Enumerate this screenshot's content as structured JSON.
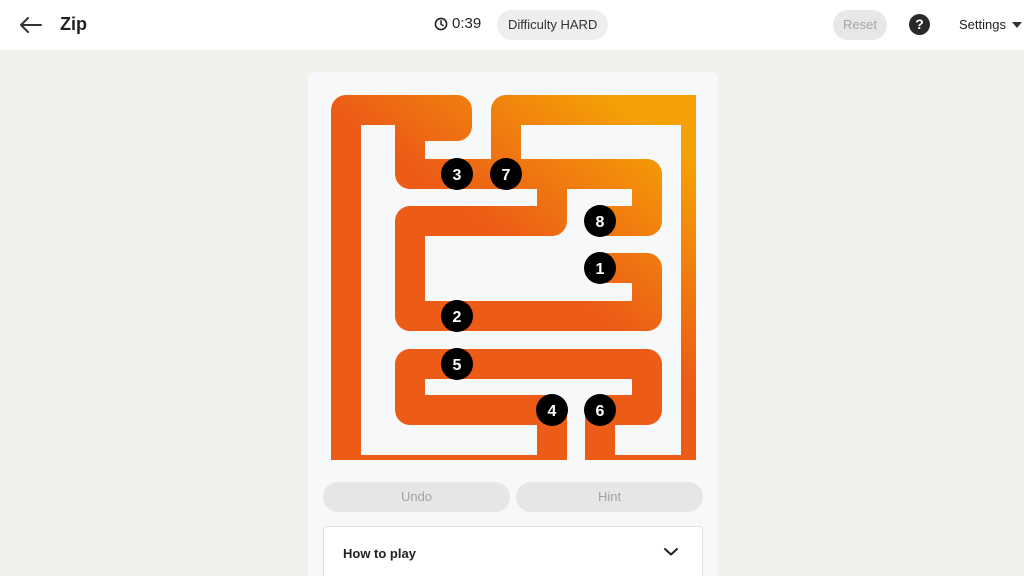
{
  "header": {
    "title": "Zip",
    "timer": "0:39",
    "difficulty": "Difficulty HARD",
    "reset_label": "Reset",
    "help_label": "?",
    "settings_label": "Settings"
  },
  "puzzle": {
    "grid_size": 7,
    "path_colors": {
      "start": "#ec5c17",
      "end": "#f5a106"
    },
    "checkpoints": [
      {
        "label": "1",
        "row": 3,
        "col": 5
      },
      {
        "label": "2",
        "row": 4,
        "col": 2
      },
      {
        "label": "3",
        "row": 1,
        "col": 2
      },
      {
        "label": "4",
        "row": 6,
        "col": 4
      },
      {
        "label": "5",
        "row": 5,
        "col": 2
      },
      {
        "label": "6",
        "row": 6,
        "col": 5
      },
      {
        "label": "7",
        "row": 1,
        "col": 3
      },
      {
        "label": "8",
        "row": 2,
        "col": 5
      }
    ]
  },
  "controls": {
    "undo_label": "Undo",
    "hint_label": "Hint"
  },
  "how_to_play": {
    "label": "How to play"
  }
}
